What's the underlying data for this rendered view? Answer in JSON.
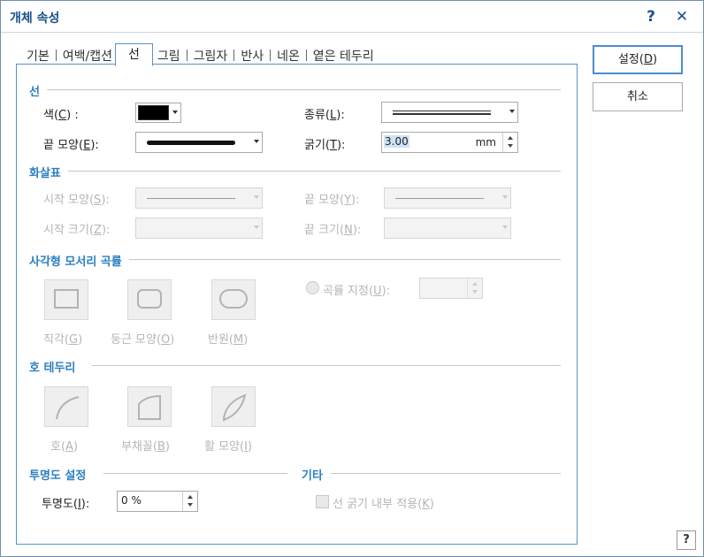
{
  "window": {
    "title": "개체 속성",
    "help_glyph": "?",
    "close_glyph": "✕"
  },
  "tabs": [
    "기본",
    "여백/캡션",
    "선",
    "그림",
    "그림자",
    "반사",
    "네온",
    "옅은 테두리"
  ],
  "active_tab": "선",
  "buttons": {
    "ok": "설정(D)",
    "ok_main": "설정(",
    "ok_key": "D",
    "ok_end": ")",
    "cancel": "취소",
    "help": "?"
  },
  "line": {
    "section": "선",
    "color_label": "색(C) :",
    "color_label_main": "색(",
    "color_label_key": "C",
    "color_label_end": ") :",
    "color_value": "#000000",
    "type_label": "종류(L):",
    "type_label_main": "종류(",
    "type_label_key": "L",
    "type_label_end": "):",
    "end_label": "끝 모양(E):",
    "end_label_main": "끝 모양(",
    "end_label_key": "E",
    "end_label_end": "):",
    "thickness_label": "굵기(T):",
    "thickness_label_main": "굵기(",
    "thickness_label_key": "T",
    "thickness_label_end": "):",
    "thickness_value": "3.00",
    "thickness_unit": "mm"
  },
  "arrow": {
    "section": "화살표",
    "start_shape_label": "시작 모양(S):",
    "start_shape_main": "시작 모양(",
    "start_shape_key": "S",
    "start_shape_end": "):",
    "end_shape_label": "끝 모양(Y):",
    "end_shape_main": "끝 모양(",
    "end_shape_key": "Y",
    "end_shape_end": "):",
    "start_size_label": "시작 크기(Z):",
    "start_size_main": "시작 크기(",
    "start_size_key": "Z",
    "start_size_end": "):",
    "end_size_label": "끝 크기(N):",
    "end_size_main": "끝 크기(",
    "end_size_key": "N",
    "end_size_end": "):"
  },
  "corner": {
    "section": "사각형 모서리 곡률",
    "square_label": "직각(G)",
    "square_main": "직각(",
    "square_key": "G",
    "square_end": ")",
    "rounded_label": "둥근 모양(O)",
    "rounded_main": "둥근 모양(",
    "rounded_key": "O",
    "rounded_end": ")",
    "half_label": "반원(M)",
    "half_main": "반원(",
    "half_key": "M",
    "half_end": ")",
    "custom_label": "곡률 지정(U):",
    "custom_main": "곡률 지정(",
    "custom_key": "U",
    "custom_end": "):"
  },
  "arc": {
    "section": "호 테두리",
    "arc_label": "호(A)",
    "arc_main": "호(",
    "arc_key": "A",
    "arc_end": ")",
    "sector_label": "부채꼴(B)",
    "sector_main": "부채꼴(",
    "sector_key": "B",
    "sector_end": ")",
    "bow_label": "활 모양(I)",
    "bow_main": "활 모양(",
    "bow_key": "I",
    "bow_end": ")"
  },
  "transparency": {
    "section": "투명도 설정",
    "label": "투명도(I):",
    "label_main": "투명도(",
    "label_key": "I",
    "label_end": "):",
    "value": "0 %"
  },
  "etc": {
    "section": "기타",
    "inner_thickness_label": "선 굵기 내부 적용(K)",
    "inner_main": "선 굵기 내부 적용(",
    "inner_key": "K",
    "inner_end": ")"
  }
}
